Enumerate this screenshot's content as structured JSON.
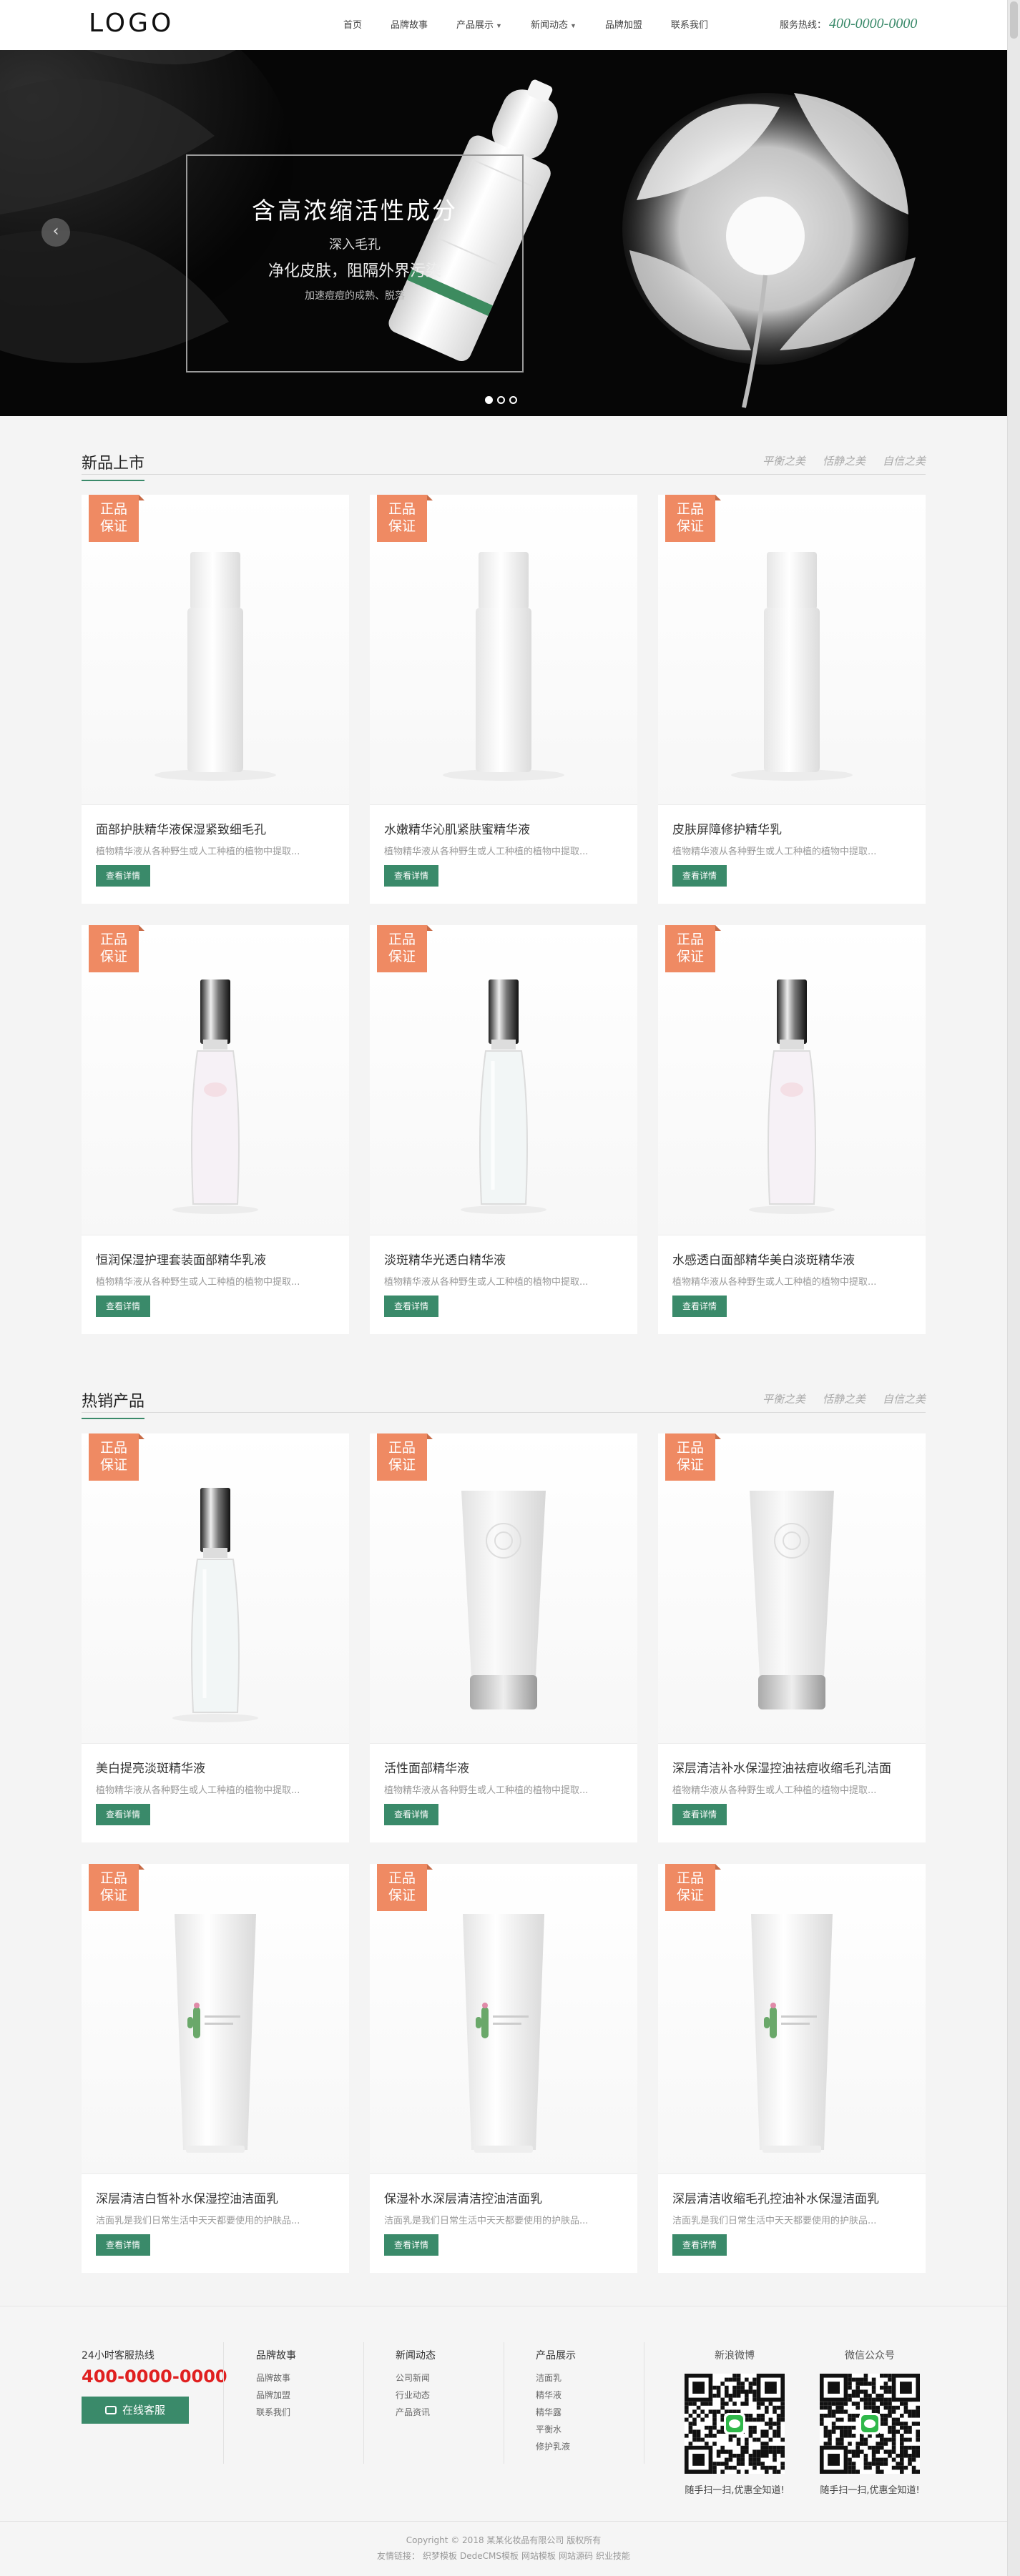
{
  "header": {
    "logo": "LOGO",
    "nav": [
      {
        "label": "首页",
        "has_dropdown": false
      },
      {
        "label": "品牌故事",
        "has_dropdown": false
      },
      {
        "label": "产品展示",
        "has_dropdown": true
      },
      {
        "label": "新闻动态",
        "has_dropdown": true
      },
      {
        "label": "品牌加盟",
        "has_dropdown": false
      },
      {
        "label": "联系我们",
        "has_dropdown": false
      }
    ],
    "hotline_label": "服务热线：",
    "hotline_number": "400-0000-0000"
  },
  "banner": {
    "title": "含高浓缩活性成分",
    "line1": "深入毛孔",
    "line2": "净化皮肤，阻隔外界污染",
    "line3": "加速痘痘的成熟、脱落",
    "prev_arrow": "‹",
    "slides_count": 3,
    "active_slide": 1
  },
  "sections": {
    "new": {
      "title": "新品上市",
      "tags": [
        "平衡之美",
        "恬静之美",
        "自信之美"
      ]
    },
    "hot": {
      "title": "热销产品",
      "tags": [
        "平衡之美",
        "恬静之美",
        "自信之美"
      ]
    }
  },
  "badge": {
    "line1": "正品",
    "line2": "保证"
  },
  "button_label": "查看详情",
  "new_products": [
    {
      "name": "面部护肤精华液保湿紧致细毛孔",
      "desc": "植物精华液从各种野生或人工种植的植物中提取...",
      "image": "white-bottle"
    },
    {
      "name": "水嫩精华沁肌紧肤蜜精华液",
      "desc": "植物精华液从各种野生或人工种植的植物中提取...",
      "image": "white-bottle"
    },
    {
      "name": "皮肤屏障修护精华乳",
      "desc": "植物精华液从各种野生或人工种植的植物中提取...",
      "image": "white-bottle"
    },
    {
      "name": "恒润保湿护理套装面部精华乳液",
      "desc": "植物精华液从各种野生或人工种植的植物中提取...",
      "image": "pink-pump-bottle"
    },
    {
      "name": "淡斑精华光透白精华液",
      "desc": "植物精华液从各种野生或人工种植的植物中提取...",
      "image": "clear-pump-bottle"
    },
    {
      "name": "水感透白面部精华美白淡斑精华液",
      "desc": "植物精华液从各种野生或人工种植的植物中提取...",
      "image": "pink-pump-bottle"
    }
  ],
  "hot_products": [
    {
      "name": "美白提亮淡斑精华液",
      "desc": "植物精华液从各种野生或人工种植的植物中提取...",
      "image": "clear-pump-bottle"
    },
    {
      "name": "活性面部精华液",
      "desc": "植物精华液从各种野生或人工种植的植物中提取...",
      "image": "rose-tube"
    },
    {
      "name": "深层清洁补水保湿控油祛痘收缩毛孔洁面",
      "desc": "植物精华液从各种野生或人工种植的植物中提取...",
      "image": "rose-tube"
    },
    {
      "name": "深层清洁白皙补水保湿控油洁面乳",
      "desc": "洁面乳是我们日常生活中天天都要使用的护肤品...",
      "image": "cactus-tube"
    },
    {
      "name": "保湿补水深层清洁控油洁面乳",
      "desc": "洁面乳是我们日常生活中天天都要使用的护肤品...",
      "image": "cactus-tube"
    },
    {
      "name": "深层清洁收缩毛孔控油补水保湿洁面乳",
      "desc": "洁面乳是我们日常生活中天天都要使用的护肤品...",
      "image": "cactus-tube"
    }
  ],
  "footer": {
    "hotline_label": "24小时客服热线",
    "hotline_number": "400-0000-0000",
    "service_button": "在线客服",
    "columns": [
      {
        "title": "品牌故事",
        "links": [
          "品牌故事",
          "品牌加盟",
          "联系我们"
        ]
      },
      {
        "title": "新闻动态",
        "links": [
          "公司新闻",
          "行业动态",
          "产品资讯"
        ]
      },
      {
        "title": "产品展示",
        "links": [
          "洁面乳",
          "精华液",
          "精华露",
          "平衡水",
          "修护乳液"
        ]
      }
    ],
    "qr": [
      {
        "title": "新浪微博",
        "caption": "随手扫一扫,优惠全知道!"
      },
      {
        "title": "微信公众号",
        "caption": "随手扫一扫,优惠全知道!"
      }
    ],
    "copyright": "Copyright © 2018 某某化妆品有限公司 版权所有",
    "links_label": "友情链接：",
    "links": [
      "织梦模板",
      "DedeCMS模板",
      "网站模板",
      "网站源码",
      "织业技能"
    ]
  },
  "colors": {
    "accent": "#3a8a6a",
    "badge": "#ef8a63",
    "hotline_red": "#e02020"
  }
}
